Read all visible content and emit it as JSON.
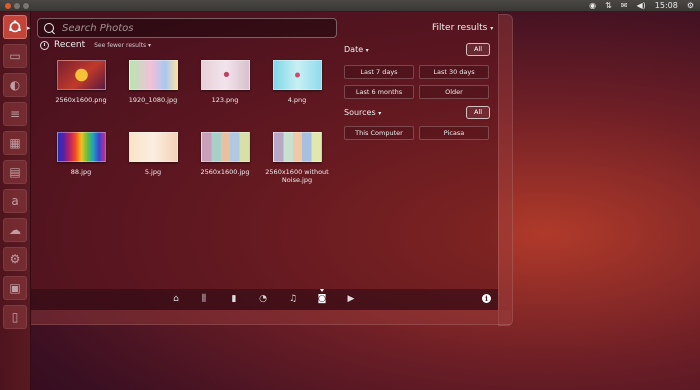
{
  "top_panel": {
    "clock": "15:08",
    "indicators": [
      "network-icon",
      "transfer-icon",
      "mail-icon",
      "volume-icon",
      "gear-icon"
    ]
  },
  "launcher": {
    "items": [
      "dash-home-icon",
      "files-icon",
      "firefox-icon",
      "libreoffice-writer-icon",
      "libreoffice-calc-icon",
      "libreoffice-impress-icon",
      "ubuntu-software-center-icon",
      "ubuntu-one-icon",
      "system-settings-icon",
      "workspace-switcher-icon",
      "trash-icon"
    ]
  },
  "dash": {
    "search_placeholder": "Search Photos",
    "filter_results": "Filter results",
    "recent_label": "Recent",
    "see_fewer": "See fewer results",
    "photos": [
      {
        "name": "2560x1600.png"
      },
      {
        "name": "1920_1080.jpg"
      },
      {
        "name": "123.png"
      },
      {
        "name": "4.png"
      },
      {
        "name": "88.jpg"
      },
      {
        "name": "5.jpg"
      },
      {
        "name": "2560x1600.jpg"
      },
      {
        "name": "2560x1600 without Noise.jpg"
      }
    ],
    "filters": {
      "date_title": "Date",
      "date_all": "All",
      "date_options": [
        "Last 7 days",
        "Last 30 days",
        "Last 6 months",
        "Older"
      ],
      "sources_title": "Sources",
      "sources_all": "All",
      "sources_options": [
        "This Computer",
        "Picasa"
      ]
    },
    "lenses": [
      "home-lens-icon",
      "applications-lens-icon",
      "files-lens-icon",
      "social-lens-icon",
      "music-lens-icon",
      "photos-lens-icon",
      "video-lens-icon"
    ],
    "active_lens": "photos-lens-icon"
  }
}
